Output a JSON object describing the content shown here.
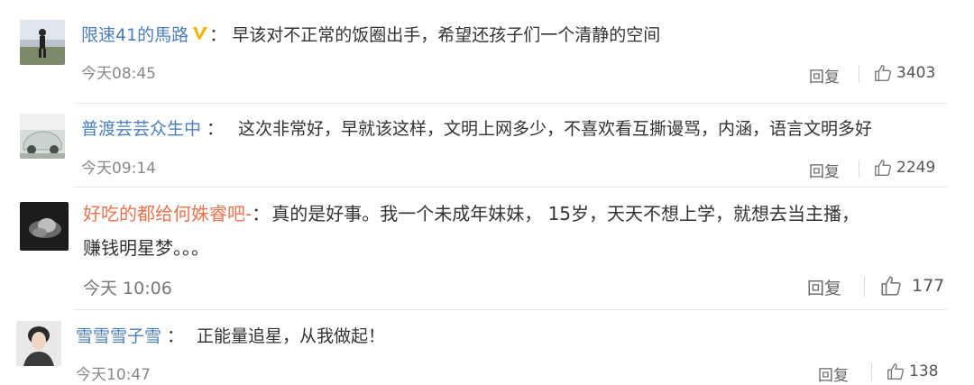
{
  "comments": [
    {
      "username": "限速41的馬路",
      "verified": true,
      "separator": "：",
      "text": "早该对不正常的饭圈出手，希望还孩子们一个清静的空间",
      "time": "今天08:45",
      "reply_label": "回复",
      "likes": "3403"
    },
    {
      "username": "普渡芸芸众生中",
      "verified": false,
      "separator": "：",
      "text": "这次非常好，早就该这样，文明上网多少，不喜欢看互撕谩骂，内涵，语言文明多好",
      "time": "今天09:14",
      "reply_label": "回复",
      "likes": "2249"
    },
    {
      "username": "好吃的都给何姝睿吧-",
      "verified": false,
      "separator": "：",
      "text": "真的是好事。我一个未成年妹妹， 15岁，天天不想上学，就想去当主播，",
      "text_line2": "赚钱明星梦。。。",
      "time": "今天 10:06",
      "reply_label": "回复",
      "likes": "177"
    },
    {
      "username": "雪雪雪子雪",
      "verified": false,
      "separator": "：",
      "text": "正能量追星，从我做起！",
      "time": "今天10:47",
      "reply_label": "回复",
      "likes": "138"
    }
  ],
  "colors": {
    "username_orange": "#eb7350",
    "username_blue": "#4a7ebc",
    "verified_badge": "#f5b400",
    "meta_gray": "#888888"
  },
  "icons": {
    "verified": "verified-v-icon",
    "like": "thumbs-up-icon"
  }
}
